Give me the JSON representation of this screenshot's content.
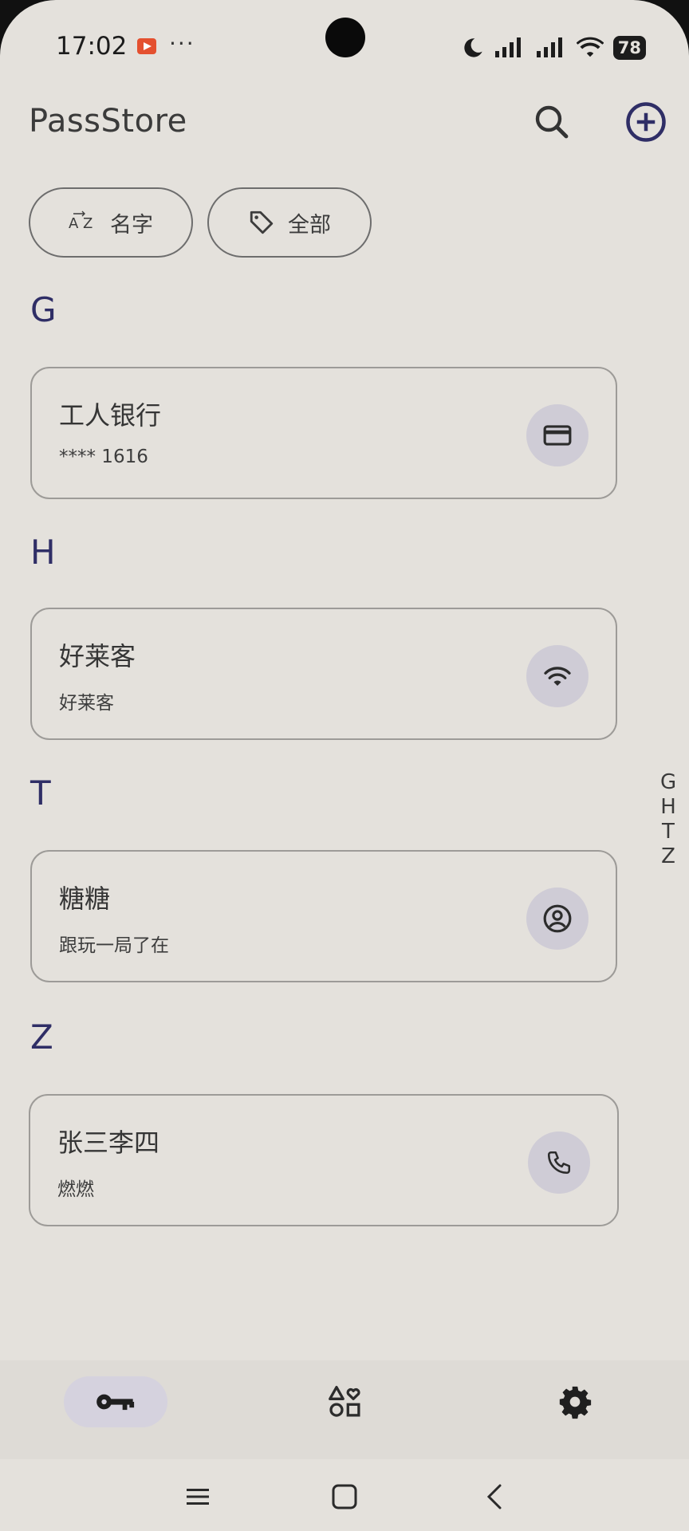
{
  "status_bar": {
    "time": "17:02",
    "more": "···",
    "battery": "78"
  },
  "app": {
    "title": "PassStore"
  },
  "filters": {
    "sort_label": "名字",
    "tag_label": "全部"
  },
  "sections": [
    {
      "letter": "G",
      "title": "工人银行",
      "subtitle": "**** 1616",
      "icon": "credit-card-icon"
    },
    {
      "letter": "H",
      "title": "好莱客",
      "subtitle": "好莱客",
      "icon": "wifi-icon"
    },
    {
      "letter": "T",
      "title": "糖糖",
      "subtitle": "跟玩一局了在",
      "icon": "account-circle-icon"
    },
    {
      "letter": "Z",
      "title": "张三李四",
      "subtitle": "燃燃",
      "icon": "phone-icon"
    }
  ],
  "alpha_index": [
    "G",
    "H",
    "T",
    "Z"
  ],
  "bottom_nav": {
    "items": [
      "key-icon",
      "shapes-icon",
      "settings-icon"
    ],
    "active": "key-icon"
  },
  "colors": {
    "background": "#e4e1dc",
    "accent": "#2f2e66",
    "badge_bg": "#cfccd6",
    "active_nav": "#d5d2de"
  }
}
